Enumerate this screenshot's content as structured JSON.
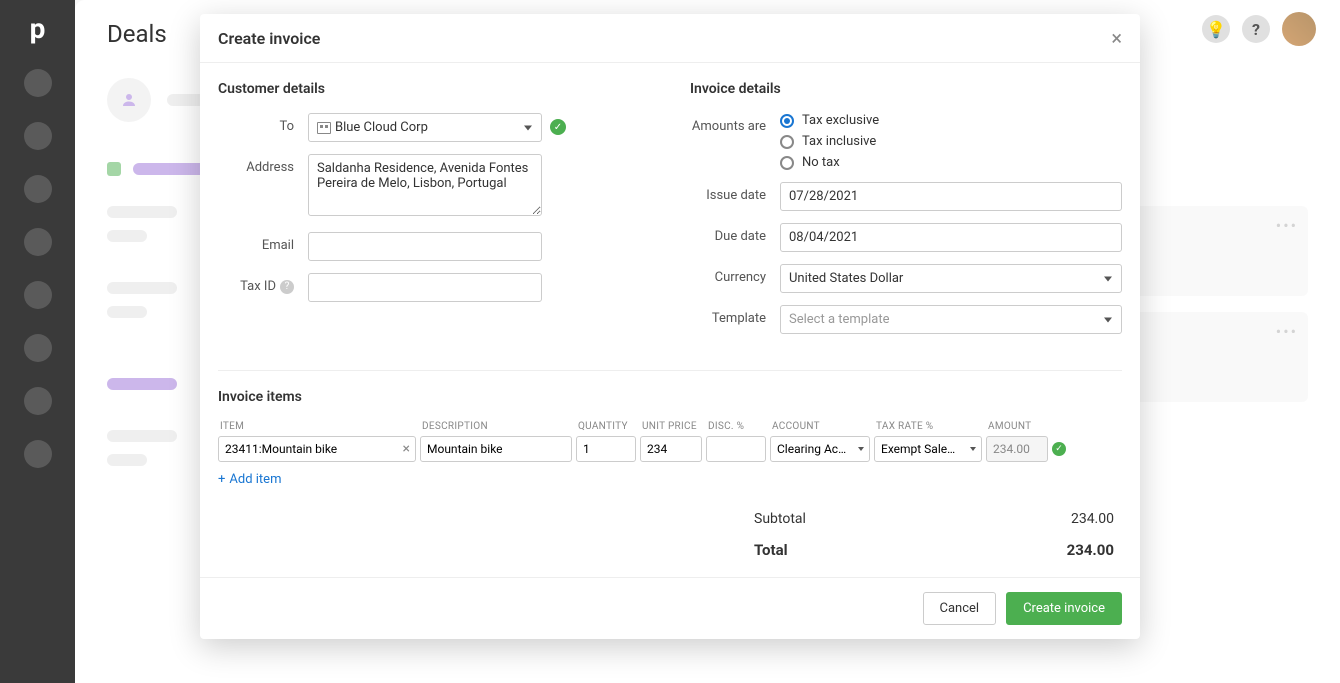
{
  "page": {
    "title": "Deals",
    "logo": "p"
  },
  "modal": {
    "title": "Create invoice",
    "customer": {
      "section_label": "Customer details",
      "to_label": "To",
      "to_value": "Blue Cloud Corp",
      "address_label": "Address",
      "address_value": "Saldanha Residence, Avenida Fontes Pereira de Melo, Lisbon, Portugal",
      "email_label": "Email",
      "email_value": "",
      "tax_id_label": "Tax ID",
      "tax_id_value": ""
    },
    "invoice": {
      "section_label": "Invoice details",
      "amounts_label": "Amounts are",
      "amounts_options": [
        "Tax exclusive",
        "Tax inclusive",
        "No tax"
      ],
      "amounts_selected": "Tax exclusive",
      "issue_date_label": "Issue date",
      "issue_date_value": "07/28/2021",
      "due_date_label": "Due date",
      "due_date_value": "08/04/2021",
      "currency_label": "Currency",
      "currency_value": "United States Dollar",
      "template_label": "Template",
      "template_placeholder": "Select a template"
    },
    "items": {
      "section_label": "Invoice items",
      "headers": {
        "item": "ITEM",
        "description": "DESCRIPTION",
        "quantity": "QUANTITY",
        "unit_price": "UNIT PRICE",
        "disc": "DISC. %",
        "account": "ACCOUNT",
        "tax_rate": "TAX RATE %",
        "amount": "AMOUNT"
      },
      "rows": [
        {
          "item": "23411:Mountain bike",
          "description": "Mountain bike",
          "quantity": "1",
          "unit_price": "234",
          "disc": "",
          "account": "Clearing Acc…",
          "tax_rate": "Exempt Sale…",
          "amount": "234.00"
        }
      ],
      "add_label": "Add item"
    },
    "totals": {
      "subtotal_label": "Subtotal",
      "subtotal_value": "234.00",
      "total_label": "Total",
      "total_value": "234.00"
    },
    "footer": {
      "cancel": "Cancel",
      "create": "Create invoice"
    }
  }
}
